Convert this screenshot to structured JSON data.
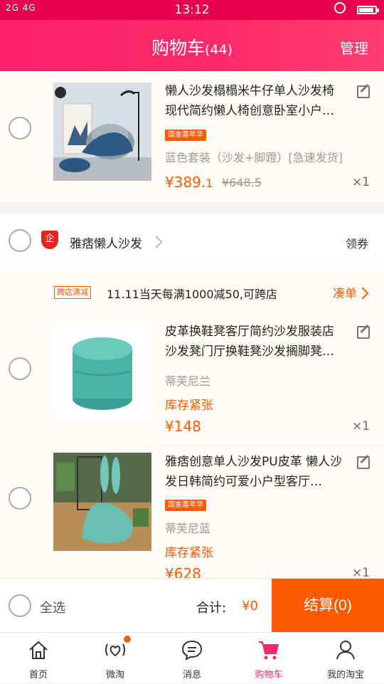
{
  "status_bar": {
    "signal": "2G  4G",
    "time": "13:12"
  },
  "header": {
    "title": "购物车",
    "count": "(44)",
    "manage": "管理"
  },
  "items": [
    {
      "title": "懒人沙发榻榻米牛仔单人沙发椅现代简约懒人椅创意卧室小户…",
      "badge": "国金嘉年华",
      "sku": "蓝色套装（沙发+脚蹬）[急速发货]",
      "price_main": "¥389.",
      "price_small": "1",
      "orig_price": "¥648.5",
      "qty": "×1"
    },
    {
      "title": "皮革换鞋凳客厅简约沙发服装店沙发凳门厅换鞋凳沙发搁脚凳…",
      "sku": "蒂芙尼兰",
      "stock": "库存紧张",
      "price_main": "¥148",
      "qty": "×1"
    },
    {
      "title": "雅痞创意单人沙发PU皮革 懒人沙发日韩简约可爱小户型客厅…",
      "badge": "国金嘉年华",
      "sku": "蒂芙尼蓝",
      "stock": "库存紧张",
      "price_main": "¥628",
      "qty": "×1"
    }
  ],
  "shop": {
    "badge": "企",
    "name": "雅痞懒人沙发",
    "coupon": "领券"
  },
  "promo": {
    "tag": "跨店满减",
    "text": "11.11当天每满1000减50,可跨店",
    "link": "凑单"
  },
  "footer": {
    "select_all": "全选",
    "total_label": "合计:",
    "total_value": "¥0",
    "checkout": "结算(0)"
  },
  "tabs": [
    {
      "label": "首页",
      "icon": "home-icon"
    },
    {
      "label": "微淘",
      "icon": "weitao-icon"
    },
    {
      "label": "消息",
      "icon": "message-icon"
    },
    {
      "label": "购物车",
      "icon": "cart-icon"
    },
    {
      "label": "我的淘宝",
      "icon": "profile-icon"
    }
  ],
  "colors": {
    "brand": "#ff2a6b",
    "accent": "#ff5a00"
  }
}
